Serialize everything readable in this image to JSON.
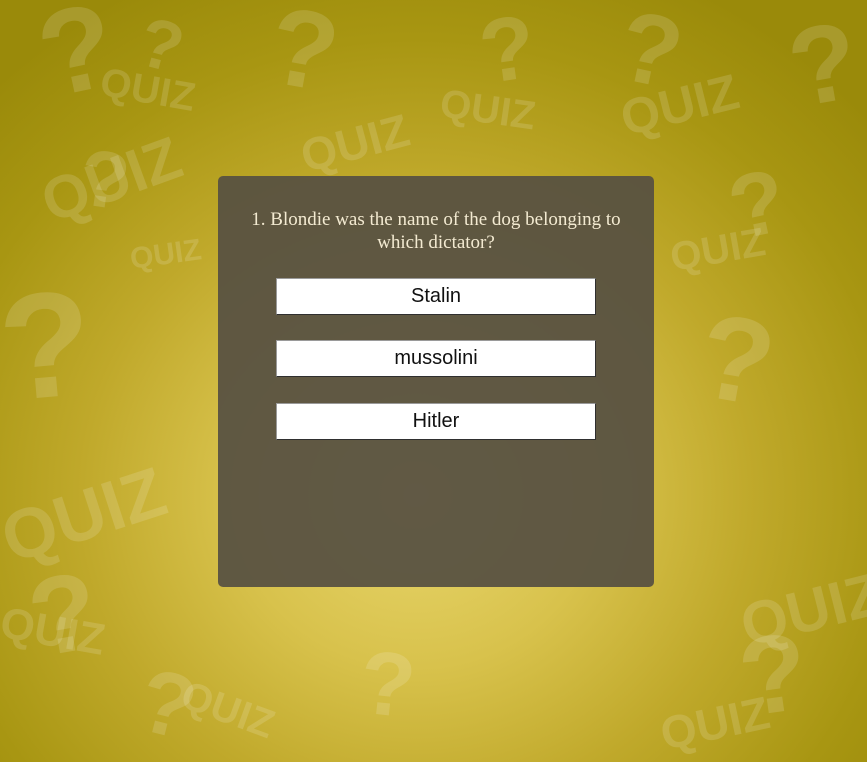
{
  "question": {
    "text": "1. Blondie was the name of the dog belonging to which dictator?"
  },
  "answers": [
    {
      "label": "Stalin"
    },
    {
      "label": "mussolini"
    },
    {
      "label": "Hitler"
    }
  ],
  "background": {
    "decor_words": [
      "QUIZ",
      "?"
    ]
  },
  "colors": {
    "panel": "#565042",
    "question_text": "#f3ead1",
    "button_bg": "#ffffff",
    "background_center": "#e9d76e",
    "background_edge": "#9a8a0a"
  }
}
